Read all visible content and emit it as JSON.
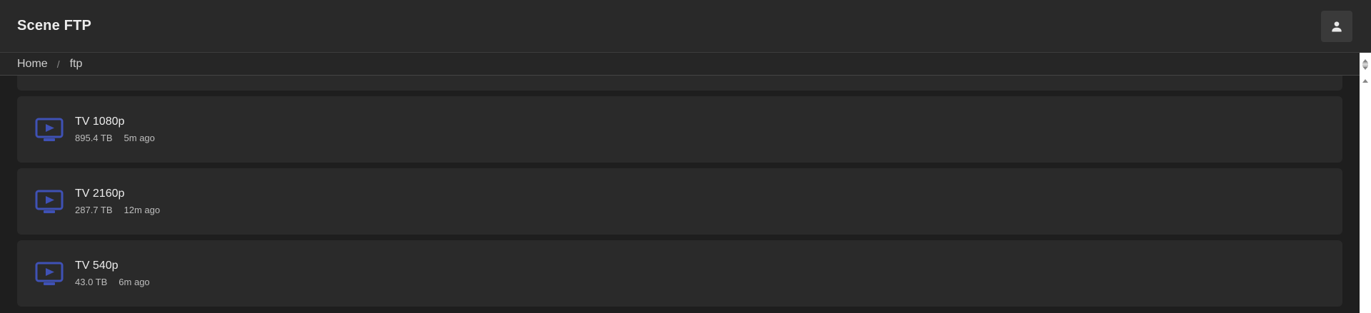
{
  "header": {
    "title": "Scene FTP",
    "user_icon": "user-icon"
  },
  "breadcrumb": {
    "home": "Home",
    "separator": "/",
    "current": "ftp"
  },
  "colors": {
    "icon_accent": "#3f51b5",
    "card_bg": "#2a2a2a",
    "page_bg": "#1e1e1e"
  },
  "folders": [
    {
      "name": "TV 1080p",
      "size": "895.4 TB",
      "modified": "5m ago",
      "icon": "tv-play-icon"
    },
    {
      "name": "TV 2160p",
      "size": "287.7 TB",
      "modified": "12m ago",
      "icon": "tv-play-icon"
    },
    {
      "name": "TV 540p",
      "size": "43.0 TB",
      "modified": "6m ago",
      "icon": "tv-play-icon"
    }
  ]
}
